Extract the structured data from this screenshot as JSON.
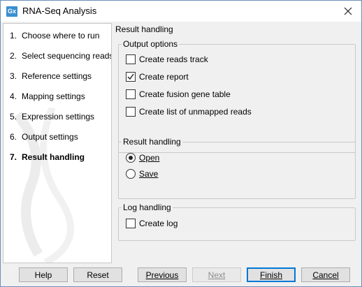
{
  "window": {
    "app_icon_text": "Gx",
    "title": "RNA-Seq Analysis"
  },
  "sidebar": {
    "steps": [
      {
        "num": "1.",
        "label": "Choose where to run"
      },
      {
        "num": "2.",
        "label": "Select sequencing reads"
      },
      {
        "num": "3.",
        "label": "Reference settings"
      },
      {
        "num": "4.",
        "label": "Mapping settings"
      },
      {
        "num": "5.",
        "label": "Expression settings"
      },
      {
        "num": "6.",
        "label": "Output settings"
      },
      {
        "num": "7.",
        "label": "Result handling",
        "active": true
      }
    ]
  },
  "content": {
    "section_title": "Result handling",
    "output_options": {
      "legend": "Output options",
      "items": [
        {
          "label": "Create reads track",
          "checked": false
        },
        {
          "label": "Create report",
          "checked": true
        },
        {
          "label": "Create fusion gene table",
          "checked": false
        },
        {
          "label": "Create list of unmapped reads",
          "checked": false
        }
      ]
    },
    "result_handling": {
      "legend": "Result handling",
      "open_label": "Open",
      "save_label": "Save",
      "selected": "Open"
    },
    "log_handling": {
      "legend": "Log handling",
      "create_log_label": "Create log",
      "create_log_checked": false
    }
  },
  "buttons": {
    "help": "Help",
    "reset": "Reset",
    "previous": "Previous",
    "next": "Next",
    "finish": "Finish",
    "cancel": "Cancel"
  }
}
